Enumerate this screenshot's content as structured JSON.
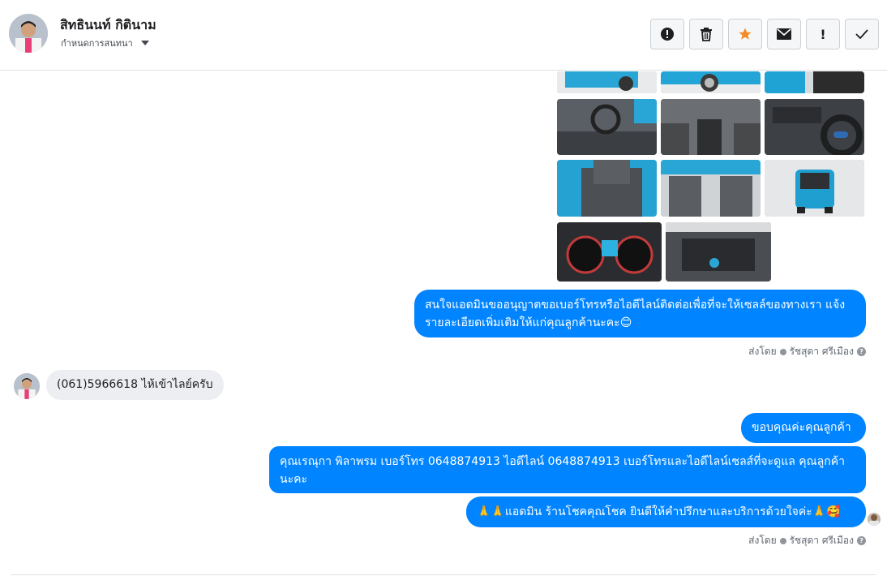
{
  "header": {
    "name": "สิทธินนท์ กิตินาม",
    "subtitle": "กำหนดการสนทนา"
  },
  "toolbar": {
    "buttons": [
      {
        "name": "report-icon",
        "glyph": "!"
      },
      {
        "name": "trash-icon",
        "glyph": "🗑"
      },
      {
        "name": "star-icon",
        "glyph": "★"
      },
      {
        "name": "mail-icon",
        "glyph": "✉"
      },
      {
        "name": "exclamation-icon",
        "glyph": "!"
      },
      {
        "name": "check-icon",
        "glyph": "✓"
      }
    ]
  },
  "messages": {
    "out1": "สนใจแอดมินขออนุญาตขอเบอร์โทรหรือไอดีไลน์ติดต่อเพื่อที่จะให้เซลล์ของทางเรา แจ้งรายละเอียดเพิ่มเติมให้แก่คุณลูกค้านะคะ😊",
    "in1": "(061)5966618 ไห้เข้าไลย์ครับ",
    "out2": "ขอบคุณค่ะคุณลูกค้า",
    "out3": "คุณเรณุกา พิลาพรม        เบอร์โทร 0648874913  ไอดีไลน์ 0648874913   เบอร์โทรและไอดีไลน์เซลส์ที่จะดูแล คุณลูกค้านะคะ",
    "out4": "🙏🙏แอดมิน ร้านโชคคุณโชค ยินดีให้คำปรึกษาและบริการด้วยใจค่ะ🙏🥰"
  },
  "sent_by": {
    "label": "ส่งโดย",
    "agent": "รัชสุดา ศรีเมือง"
  }
}
